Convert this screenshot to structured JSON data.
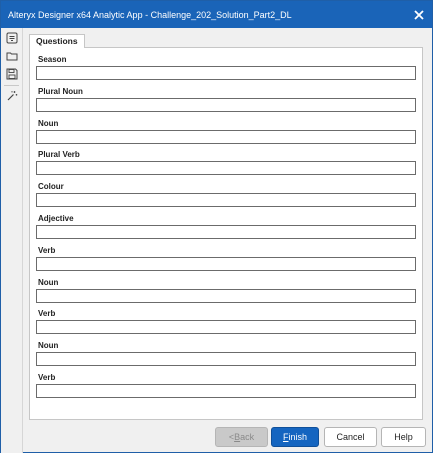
{
  "window": {
    "title": "Alteryx Designer x64 Analytic App - Challenge_202_Solution_Part2_DL",
    "close_icon": "close-icon",
    "accent": "#1a64b8"
  },
  "toolbar": {
    "icons": [
      "app-icon",
      "open-folder-icon",
      "save-icon",
      "magic-wand-icon"
    ]
  },
  "tabs": [
    {
      "label": "Questions",
      "active": true
    }
  ],
  "fields": [
    {
      "label": "Season",
      "value": ""
    },
    {
      "label": "Plural Noun",
      "value": ""
    },
    {
      "label": "Noun",
      "value": ""
    },
    {
      "label": "Plural Verb",
      "value": ""
    },
    {
      "label": "Colour",
      "value": ""
    },
    {
      "label": "Adjective",
      "value": ""
    },
    {
      "label": "Verb",
      "value": ""
    },
    {
      "label": "Noun",
      "value": ""
    },
    {
      "label": "Verb",
      "value": ""
    },
    {
      "label": "Noun",
      "value": ""
    },
    {
      "label": "Verb",
      "value": ""
    }
  ],
  "buttons": {
    "back_prefix": "< ",
    "back_mnemonic": "B",
    "back_rest": "ack",
    "finish_mnemonic": "F",
    "finish_rest": "inish",
    "cancel": "Cancel",
    "help": "Help",
    "finish_color": "#1565c0"
  }
}
